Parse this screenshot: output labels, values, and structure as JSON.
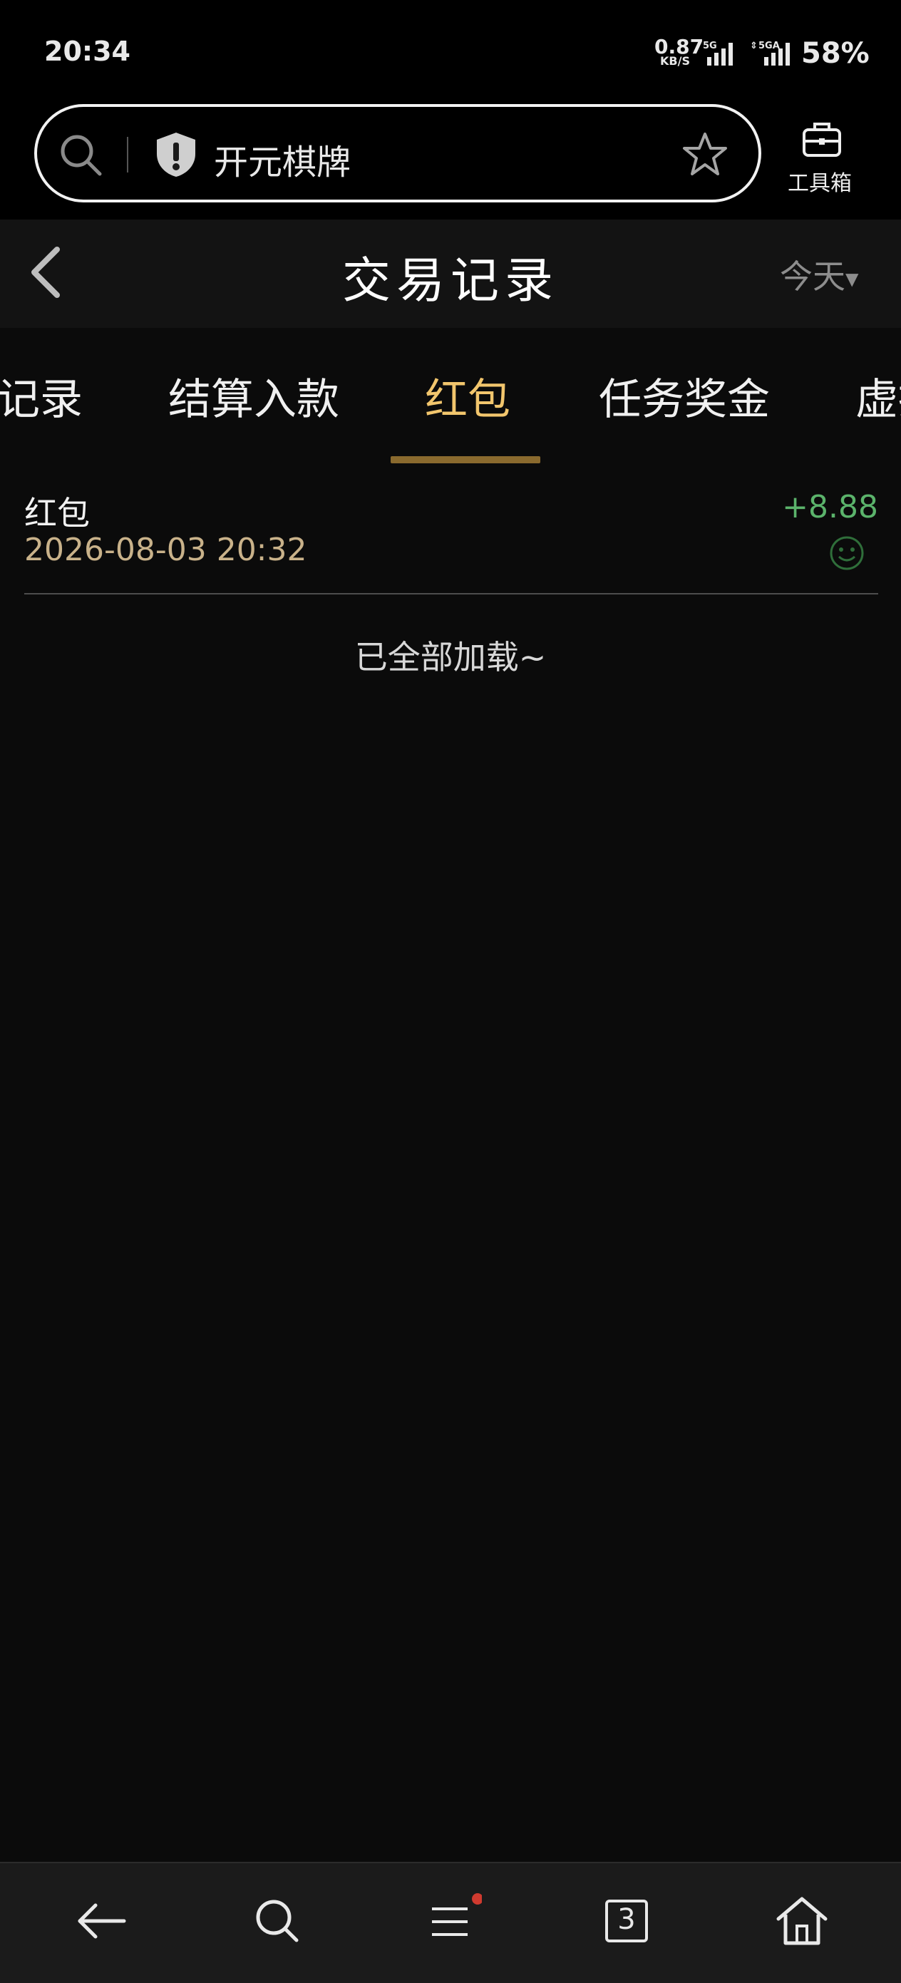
{
  "status_bar": {
    "time": "20:34",
    "net_speed_value": "0.87",
    "net_speed_unit": "KB/S",
    "sim1_label": "5G",
    "sim2_label": "5GA",
    "battery": "58%"
  },
  "browser": {
    "site_name": "开元棋牌",
    "toolbox_label": "工具箱",
    "open_tabs": "3"
  },
  "header": {
    "title": "交易记录",
    "date_filter": "今天"
  },
  "tabs": [
    {
      "label": "记录",
      "active": false
    },
    {
      "label": "结算入款",
      "active": false
    },
    {
      "label": "红包",
      "active": true
    },
    {
      "label": "任务奖金",
      "active": false
    },
    {
      "label": "虚拟",
      "active": false
    }
  ],
  "transactions": [
    {
      "title": "红包",
      "time": "2026-08-03 20:32",
      "amount": "+8.88"
    }
  ],
  "footer_text": "已全部加载~",
  "colors": {
    "accent": "#f2c66d",
    "amount_positive": "#5bb36b",
    "time_text": "#c9b28a"
  }
}
